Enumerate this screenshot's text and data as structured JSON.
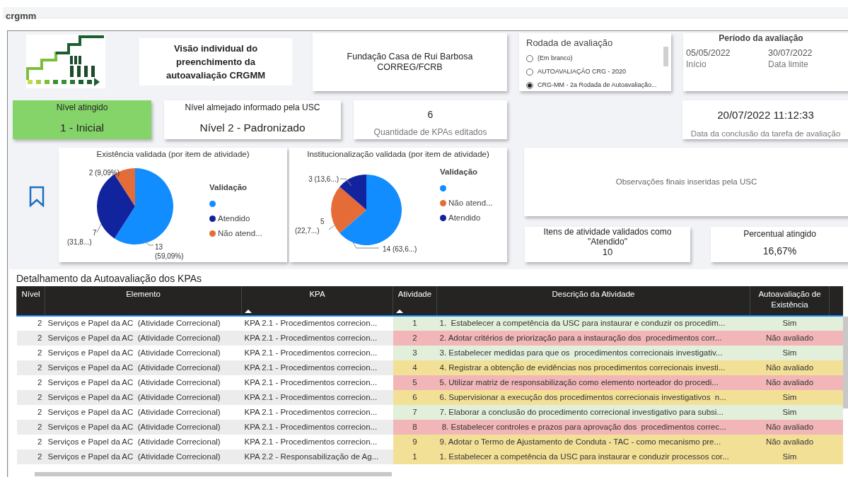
{
  "page_title": "crgmm",
  "header": {
    "title": "Visão individual do preenchimento da autoavaliação CRGMM",
    "org_line_1": "Fundação Casa de Rui Barbosa",
    "org_line_2": "CORREG/FCRB"
  },
  "round_slicer": {
    "title": "Rodada de avaliação",
    "options": [
      {
        "label": "(Em branco)",
        "selected": false
      },
      {
        "label": "AUTOAVALIAÇÃO CRG - 2020",
        "selected": false
      },
      {
        "label": "CRG-MM - 2a Rodada de Autoavaliação...",
        "selected": true
      }
    ]
  },
  "period": {
    "title": "Período da avaliação",
    "start": "05/05/2022",
    "start_label": "Início",
    "end": "30/07/2022",
    "end_label": "Data limite"
  },
  "cards": [
    {
      "kind": "level",
      "label": "Nível atingido",
      "value": "1 - Inicial",
      "color": "#85d46a"
    },
    {
      "kind": "level",
      "label": "Nível almejado informado pela USC",
      "value": "Nível 2 - Padronizado",
      "color": "#ffffff"
    },
    {
      "kind": "count",
      "label": "Quantidade de KPAs editados",
      "value": "6"
    },
    {
      "kind": "date",
      "label": "Data da conclusão da tarefa de avaliação",
      "value": "20/07/2022 11:12:33"
    }
  ],
  "charts": [
    {
      "chart_data": {
        "type": "pie",
        "title": "Existência validada (por item de atividade)",
        "categories": [
          null,
          "Atendido",
          "Não atend..."
        ],
        "series": [
          {
            "name": "Validação",
            "values": [
              59.09,
              31.82,
              9.09
            ]
          }
        ],
        "colors": [
          "#118dff",
          "#12239e",
          "#e66c37"
        ],
        "value_labels": [
          "13 (59,09%)",
          "7 (31,8...)",
          "2 (9,09%)"
        ]
      }
    },
    {
      "chart_data": {
        "type": "pie",
        "title": "Institucionalização validada (por item de atividade)",
        "categories": [
          null,
          "Não atend...",
          "Atendido"
        ],
        "series": [
          {
            "name": "Validação",
            "values": [
              63.64,
              22.73,
              13.63
            ]
          }
        ],
        "colors": [
          "#118dff",
          "#e66c37",
          "#12239e"
        ],
        "value_labels": [
          "14 (63,6...)",
          "5 (22,7...)",
          "3 (13,6...)"
        ]
      }
    }
  ],
  "observations": {
    "placeholder": "Observações finais inseridas pela USC"
  },
  "validated_card": {
    "label": "Itens de atividade validados como \"Atendido\"",
    "value": "10"
  },
  "percent_card": {
    "label": "Percentual atingido",
    "value": "16,67%"
  },
  "table": {
    "title": "Detalhamento da Autoavaliação dos KPAs",
    "columns": [
      {
        "label": "Nível",
        "sorted": false
      },
      {
        "label": "Elemento",
        "sorted": false
      },
      {
        "label": "KPA",
        "sorted": true
      },
      {
        "label": "Atividade",
        "sorted": true
      },
      {
        "label": "Descrição da Atividade",
        "sorted": false
      },
      {
        "label": "Autoavaliação de Existência",
        "sorted": false
      }
    ],
    "rows": [
      {
        "cells": [
          "2",
          "Serviços e Papel da AC  (Atividade Correcional)",
          "KPA 2.1 - Procedimentos correcion...",
          "1",
          "1.  Estabelecer a competência da USC para instaurar e conduzir os procedim...",
          "Sim"
        ],
        "color": "#e2efda"
      },
      {
        "cells": [
          "2",
          "Serviços e Papel da AC  (Atividade Correcional)",
          "KPA 2.1 - Procedimentos correcion...",
          "2",
          "2. Adotar critérios de priorização para a instauração dos  procedimentos corr...",
          "Não avaliado"
        ],
        "color": "#f2b6b8"
      },
      {
        "cells": [
          "2",
          "Serviços e Papel da AC  (Atividade Correcional)",
          "KPA 2.1 - Procedimentos correcion...",
          "3",
          "3. Estabelecer medidas para que os  procedimentos correcionais investigativ...",
          "Sim"
        ],
        "color": "#e2efda"
      },
      {
        "cells": [
          "2",
          "Serviços e Papel da AC  (Atividade Correcional)",
          "KPA 2.1 - Procedimentos correcion...",
          "4",
          "4. Registrar a obtenção de evidências nos procedimentos correcionais investi...",
          "Não avaliado"
        ],
        "color": "#f3e097"
      },
      {
        "cells": [
          "2",
          "Serviços e Papel da AC  (Atividade Correcional)",
          "KPA 2.1 - Procedimentos correcion...",
          "5",
          "5. Utilizar matriz de responsabilização como elemento norteador do procedi...",
          "Não avaliado"
        ],
        "color": "#f2b6b8"
      },
      {
        "cells": [
          "2",
          "Serviços e Papel da AC  (Atividade Correcional)",
          "KPA 2.1 - Procedimentos correcion...",
          "6",
          "6. Supervisionar a execução dos procedimentos correcionais investigativos  n...",
          "Sim"
        ],
        "color": "#f3e097"
      },
      {
        "cells": [
          "2",
          "Serviços e Papel da AC  (Atividade Correcional)",
          "KPA 2.1 - Procedimentos correcion...",
          "7",
          "7. Elaborar a conclusão do procedimento correcional investigativo para subsi...",
          "Sim"
        ],
        "color": "#e2efda"
      },
      {
        "cells": [
          "2",
          "Serviços e Papel da AC  (Atividade Correcional)",
          "KPA 2.1 - Procedimentos correcion...",
          "8",
          " 8. Estabelecer controles e prazos para aprovação dos  procedimentos correc...",
          "Não avaliado"
        ],
        "color": "#f2b6b8"
      },
      {
        "cells": [
          "2",
          "Serviços e Papel da AC  (Atividade Correcional)",
          "KPA 2.1 - Procedimentos correcion...",
          "9",
          "9. Adotar o Termo de Ajustamento de Conduta - TAC - como mecanismo pre...",
          "Não avaliado"
        ],
        "color": "#f3e097"
      },
      {
        "cells": [
          "2",
          "Serviços e Papel da AC  (Atividade Correcional)",
          "KPA 2.2 - Responsabilização de Ag...",
          "1",
          "1. Estabelecer a competência da USC para instaurar e conduzir processos cor...",
          "Sim"
        ],
        "color": "#f3e097"
      }
    ]
  }
}
